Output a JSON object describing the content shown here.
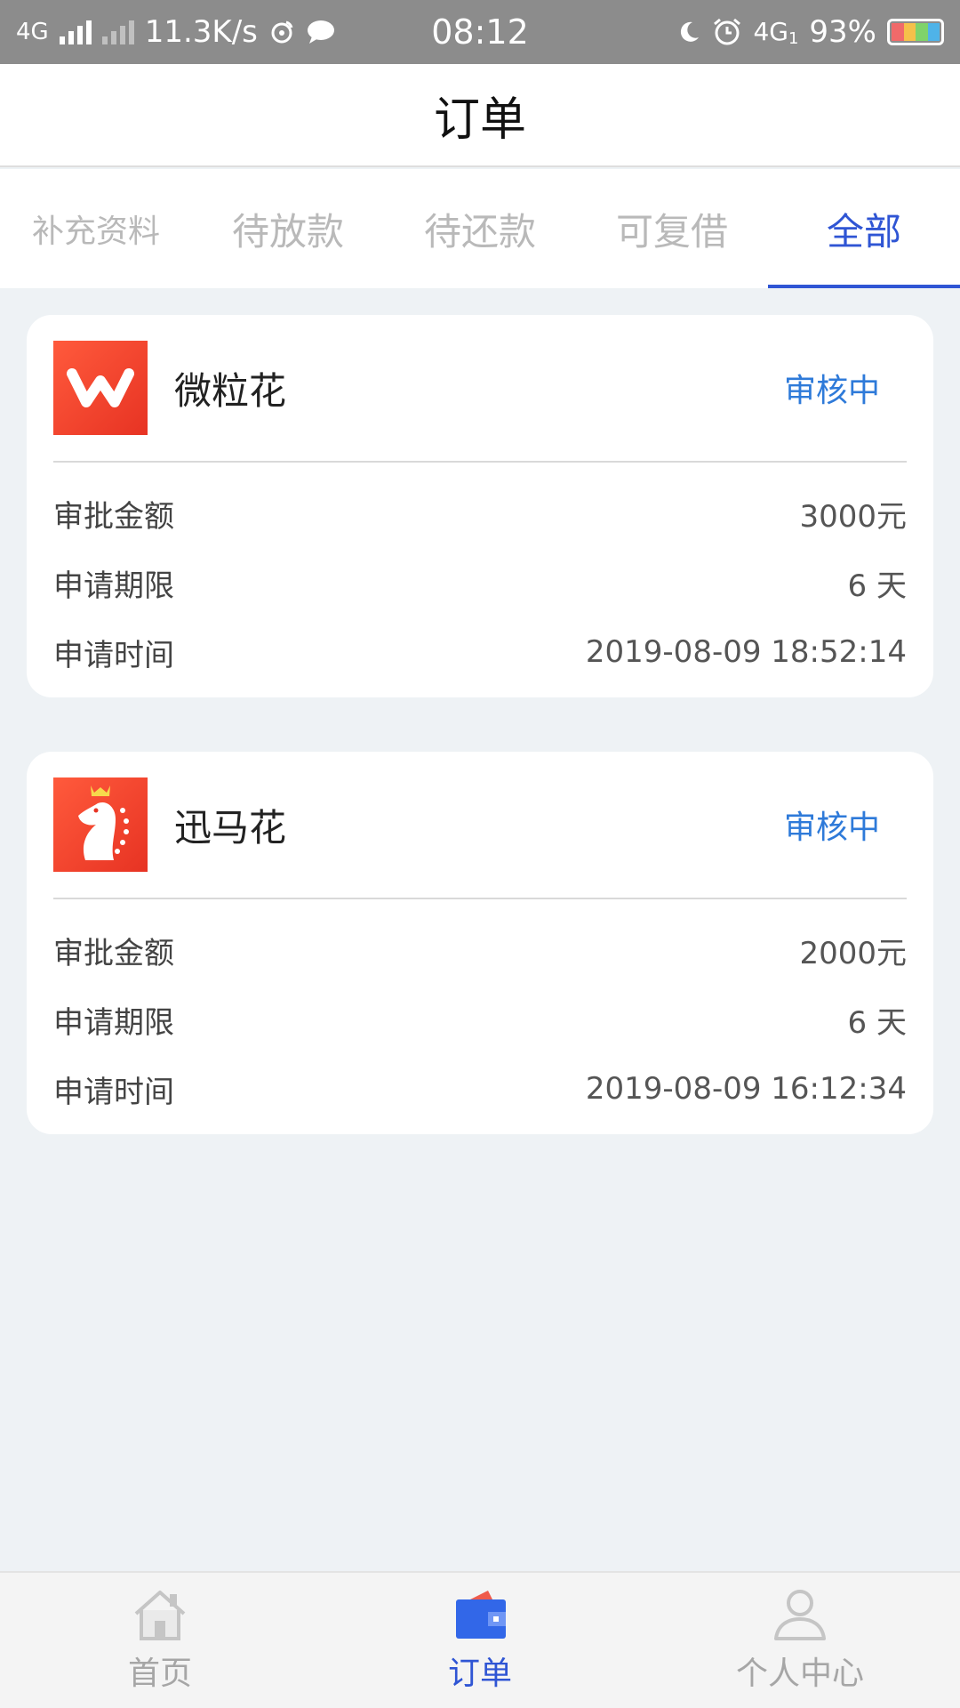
{
  "status_bar": {
    "network_type": "4G",
    "speed": "11.3K/s",
    "time": "08:12",
    "net_badge": "4G",
    "net_badge_sub": "1",
    "battery": "93%"
  },
  "header": {
    "title": "订单"
  },
  "tabs": [
    {
      "label": "补充资料",
      "active": false
    },
    {
      "label": "待放款",
      "active": false
    },
    {
      "label": "待还款",
      "active": false
    },
    {
      "label": "可复借",
      "active": false
    },
    {
      "label": "全部",
      "active": true
    }
  ],
  "orders": [
    {
      "lender": "微粒花",
      "logo_icon": "w-logo-icon",
      "status": "审核中",
      "rows": [
        {
          "label": "审批金额",
          "value": "3000元"
        },
        {
          "label": "申请期限",
          "value": "6 天"
        },
        {
          "label": "申请时间",
          "value": "2019-08-09 18:52:14"
        }
      ]
    },
    {
      "lender": "迅马花",
      "logo_icon": "horse-logo-icon",
      "status": "审核中",
      "rows": [
        {
          "label": "审批金额",
          "value": "2000元"
        },
        {
          "label": "申请期限",
          "value": "6 天"
        },
        {
          "label": "申请时间",
          "value": "2019-08-09 16:12:34"
        }
      ]
    }
  ],
  "bottom_nav": [
    {
      "label": "首页",
      "icon": "home-icon",
      "active": false
    },
    {
      "label": "订单",
      "icon": "wallet-icon",
      "active": true
    },
    {
      "label": "个人中心",
      "icon": "user-icon",
      "active": false
    }
  ],
  "colors": {
    "accent": "#2f55d4",
    "status": "#2e7ad9",
    "logo_red": "#e73323",
    "background": "#eef2f5"
  }
}
